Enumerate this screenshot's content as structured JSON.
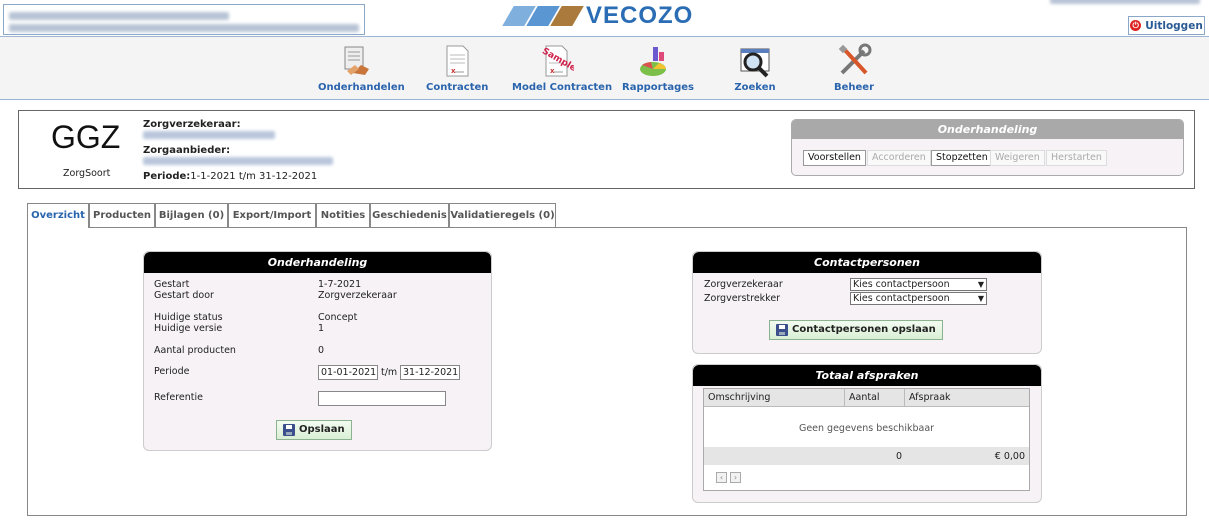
{
  "header": {
    "logo_text": "VECOZO",
    "logout_label": "Uitloggen"
  },
  "toolbar": {
    "items": [
      {
        "label": "Onderhandelen",
        "icon": "onderhandelen-icon"
      },
      {
        "label": "Contracten",
        "icon": "contracten-icon"
      },
      {
        "label": "Model Contracten",
        "icon": "model-contracten-icon",
        "badge": "Sample"
      },
      {
        "label": "Rapportages",
        "icon": "rapportages-icon"
      },
      {
        "label": "Zoeken",
        "icon": "zoeken-icon"
      },
      {
        "label": "Beheer",
        "icon": "beheer-icon"
      }
    ]
  },
  "info": {
    "code": "GGZ",
    "code_caption": "ZorgSoort",
    "zorgverzekeraar_label": "Zorgverzekeraar:",
    "zorgaanbieder_label": "Zorgaanbieder:",
    "periode_label": "Periode:",
    "periode_value": "1-1-2021 t/m 31-12-2021"
  },
  "negotiation_panel": {
    "title": "Onderhandeling",
    "buttons": [
      {
        "label": "Voorstellen",
        "enabled": true
      },
      {
        "label": "Accorderen",
        "enabled": false
      },
      {
        "label": "Stopzetten",
        "enabled": true
      },
      {
        "label": "Weigeren",
        "enabled": false
      },
      {
        "label": "Herstarten",
        "enabled": false
      }
    ]
  },
  "tabs": [
    {
      "label": "Overzicht",
      "active": true
    },
    {
      "label": "Producten",
      "active": false
    },
    {
      "label": "Bijlagen (0)",
      "active": false
    },
    {
      "label": "Export/Import",
      "active": false
    },
    {
      "label": "Notities",
      "active": false
    },
    {
      "label": "Geschiedenis",
      "active": false
    },
    {
      "label": "Validatieregels (0)",
      "active": false
    }
  ],
  "overview": {
    "title": "Onderhandeling",
    "gestart_label": "Gestart",
    "gestart_value": "1-7-2021",
    "gestart_door_label": "Gestart door",
    "gestart_door_value": "Zorgverzekeraar",
    "status_label": "Huidige status",
    "status_value": "Concept",
    "versie_label": "Huidige versie",
    "versie_value": "1",
    "aantal_label": "Aantal producten",
    "aantal_value": "0",
    "periode_label": "Periode",
    "periode_from": "01-01-2021",
    "periode_sep": "t/m",
    "periode_to": "31-12-2021",
    "referentie_label": "Referentie",
    "referentie_value": "",
    "save_label": "Opslaan"
  },
  "contacts": {
    "title": "Contactpersonen",
    "zorgverzekeraar_label": "Zorgverzekeraar",
    "zorgverstrekker_label": "Zorgverstrekker",
    "select_value": "Kies contactpersoon",
    "save_label": "Contactpersonen opslaan"
  },
  "totals": {
    "title": "Totaal afspraken",
    "columns": [
      "Omschrijving",
      "Aantal",
      "Afspraak"
    ],
    "empty_text": "Geen gegevens beschikbaar",
    "total_count": "0",
    "total_amount": "€ 0,00"
  }
}
